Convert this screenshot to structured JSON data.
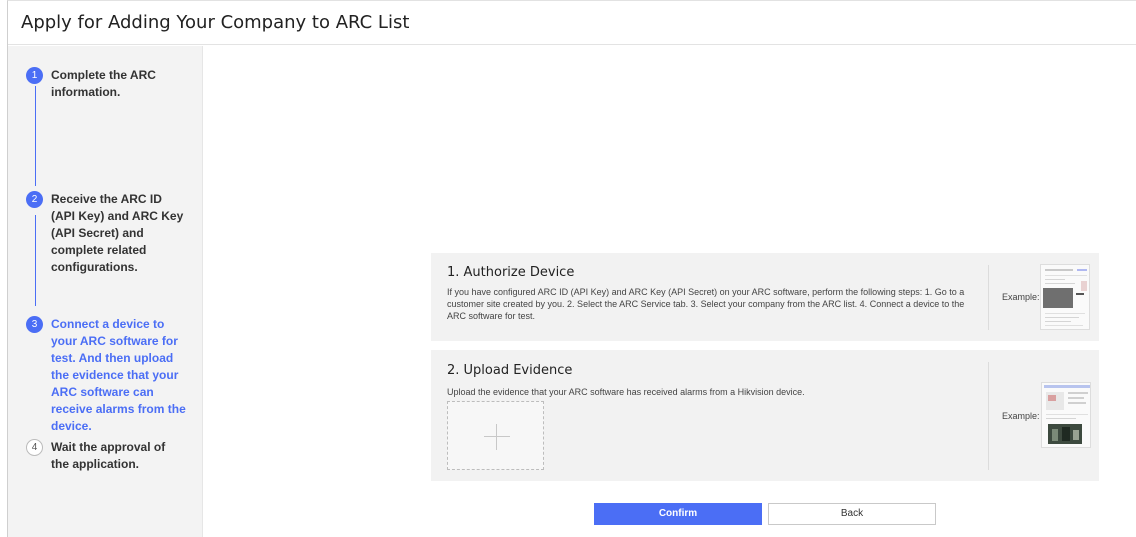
{
  "page": {
    "title": "Apply for Adding Your Company to ARC List"
  },
  "steps": [
    {
      "number": "1",
      "label": "Complete the ARC information.",
      "state": "done"
    },
    {
      "number": "2",
      "label": "Receive the ARC ID (API Key) and ARC Key (API Secret) and complete related configurations.",
      "state": "done"
    },
    {
      "number": "3",
      "label": "Connect a device to your ARC software for test. And then upload the evidence that your ARC software can receive alarms from the device.",
      "state": "active"
    },
    {
      "number": "4",
      "label": "Wait the approval of the application.",
      "state": "pending"
    }
  ],
  "authorize": {
    "title": "1. Authorize Device",
    "description": "If you have configured ARC ID (API Key) and ARC Key (API Secret) on your ARC software, perform the following steps: 1. Go to a customer site created by you. 2. Select the ARC Service tab. 3. Select your company from the ARC list. 4. Connect a device to the ARC software for test.",
    "example_label": "Example:"
  },
  "upload": {
    "title": "2. Upload Evidence",
    "description": "Upload the evidence that your ARC software has received alarms from a Hikvision device.",
    "example_label": "Example:"
  },
  "actions": {
    "confirm": "Confirm",
    "back": "Back"
  },
  "colors": {
    "accent": "#4b6ef5",
    "card_bg": "#f2f2f2",
    "sidebar_bg": "#f3f3f3"
  }
}
